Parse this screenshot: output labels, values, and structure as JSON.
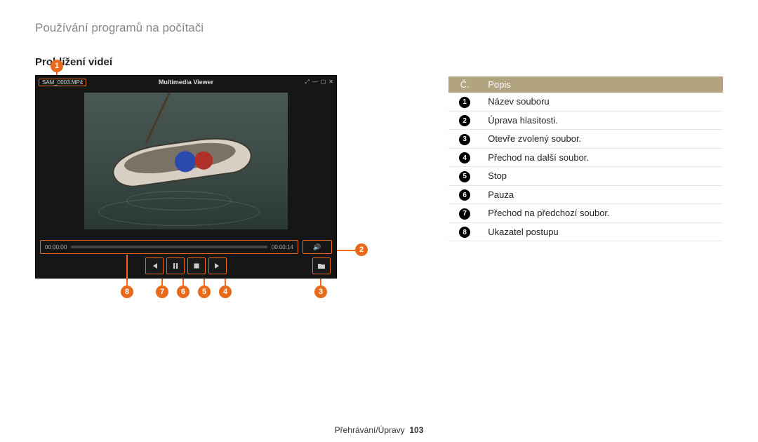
{
  "breadcrumb": "Používání programů na počítači",
  "subheading": "Prohlížení videí",
  "viewer": {
    "filename": "SAM_0003.MP4",
    "title": "Multimedia Viewer",
    "time_start": "00:00:00",
    "time_end": "00:00:14"
  },
  "table": {
    "header_num": "Č.",
    "header_desc": "Popis",
    "rows": [
      {
        "n": "1",
        "desc": "Název souboru"
      },
      {
        "n": "2",
        "desc": "Úprava hlasitosti."
      },
      {
        "n": "3",
        "desc": "Otevře zvolený soubor."
      },
      {
        "n": "4",
        "desc": "Přechod na další soubor."
      },
      {
        "n": "5",
        "desc": "Stop"
      },
      {
        "n": "6",
        "desc": "Pauza"
      },
      {
        "n": "7",
        "desc": "Přechod na předchozí soubor."
      },
      {
        "n": "8",
        "desc": "Ukazatel postupu"
      }
    ]
  },
  "footer": {
    "section": "Přehrávání/Úpravy",
    "page": "103"
  },
  "callouts": {
    "c1": "1",
    "c2": "2",
    "c3": "3",
    "c4": "4",
    "c5": "5",
    "c6": "6",
    "c7": "7",
    "c8": "8"
  }
}
